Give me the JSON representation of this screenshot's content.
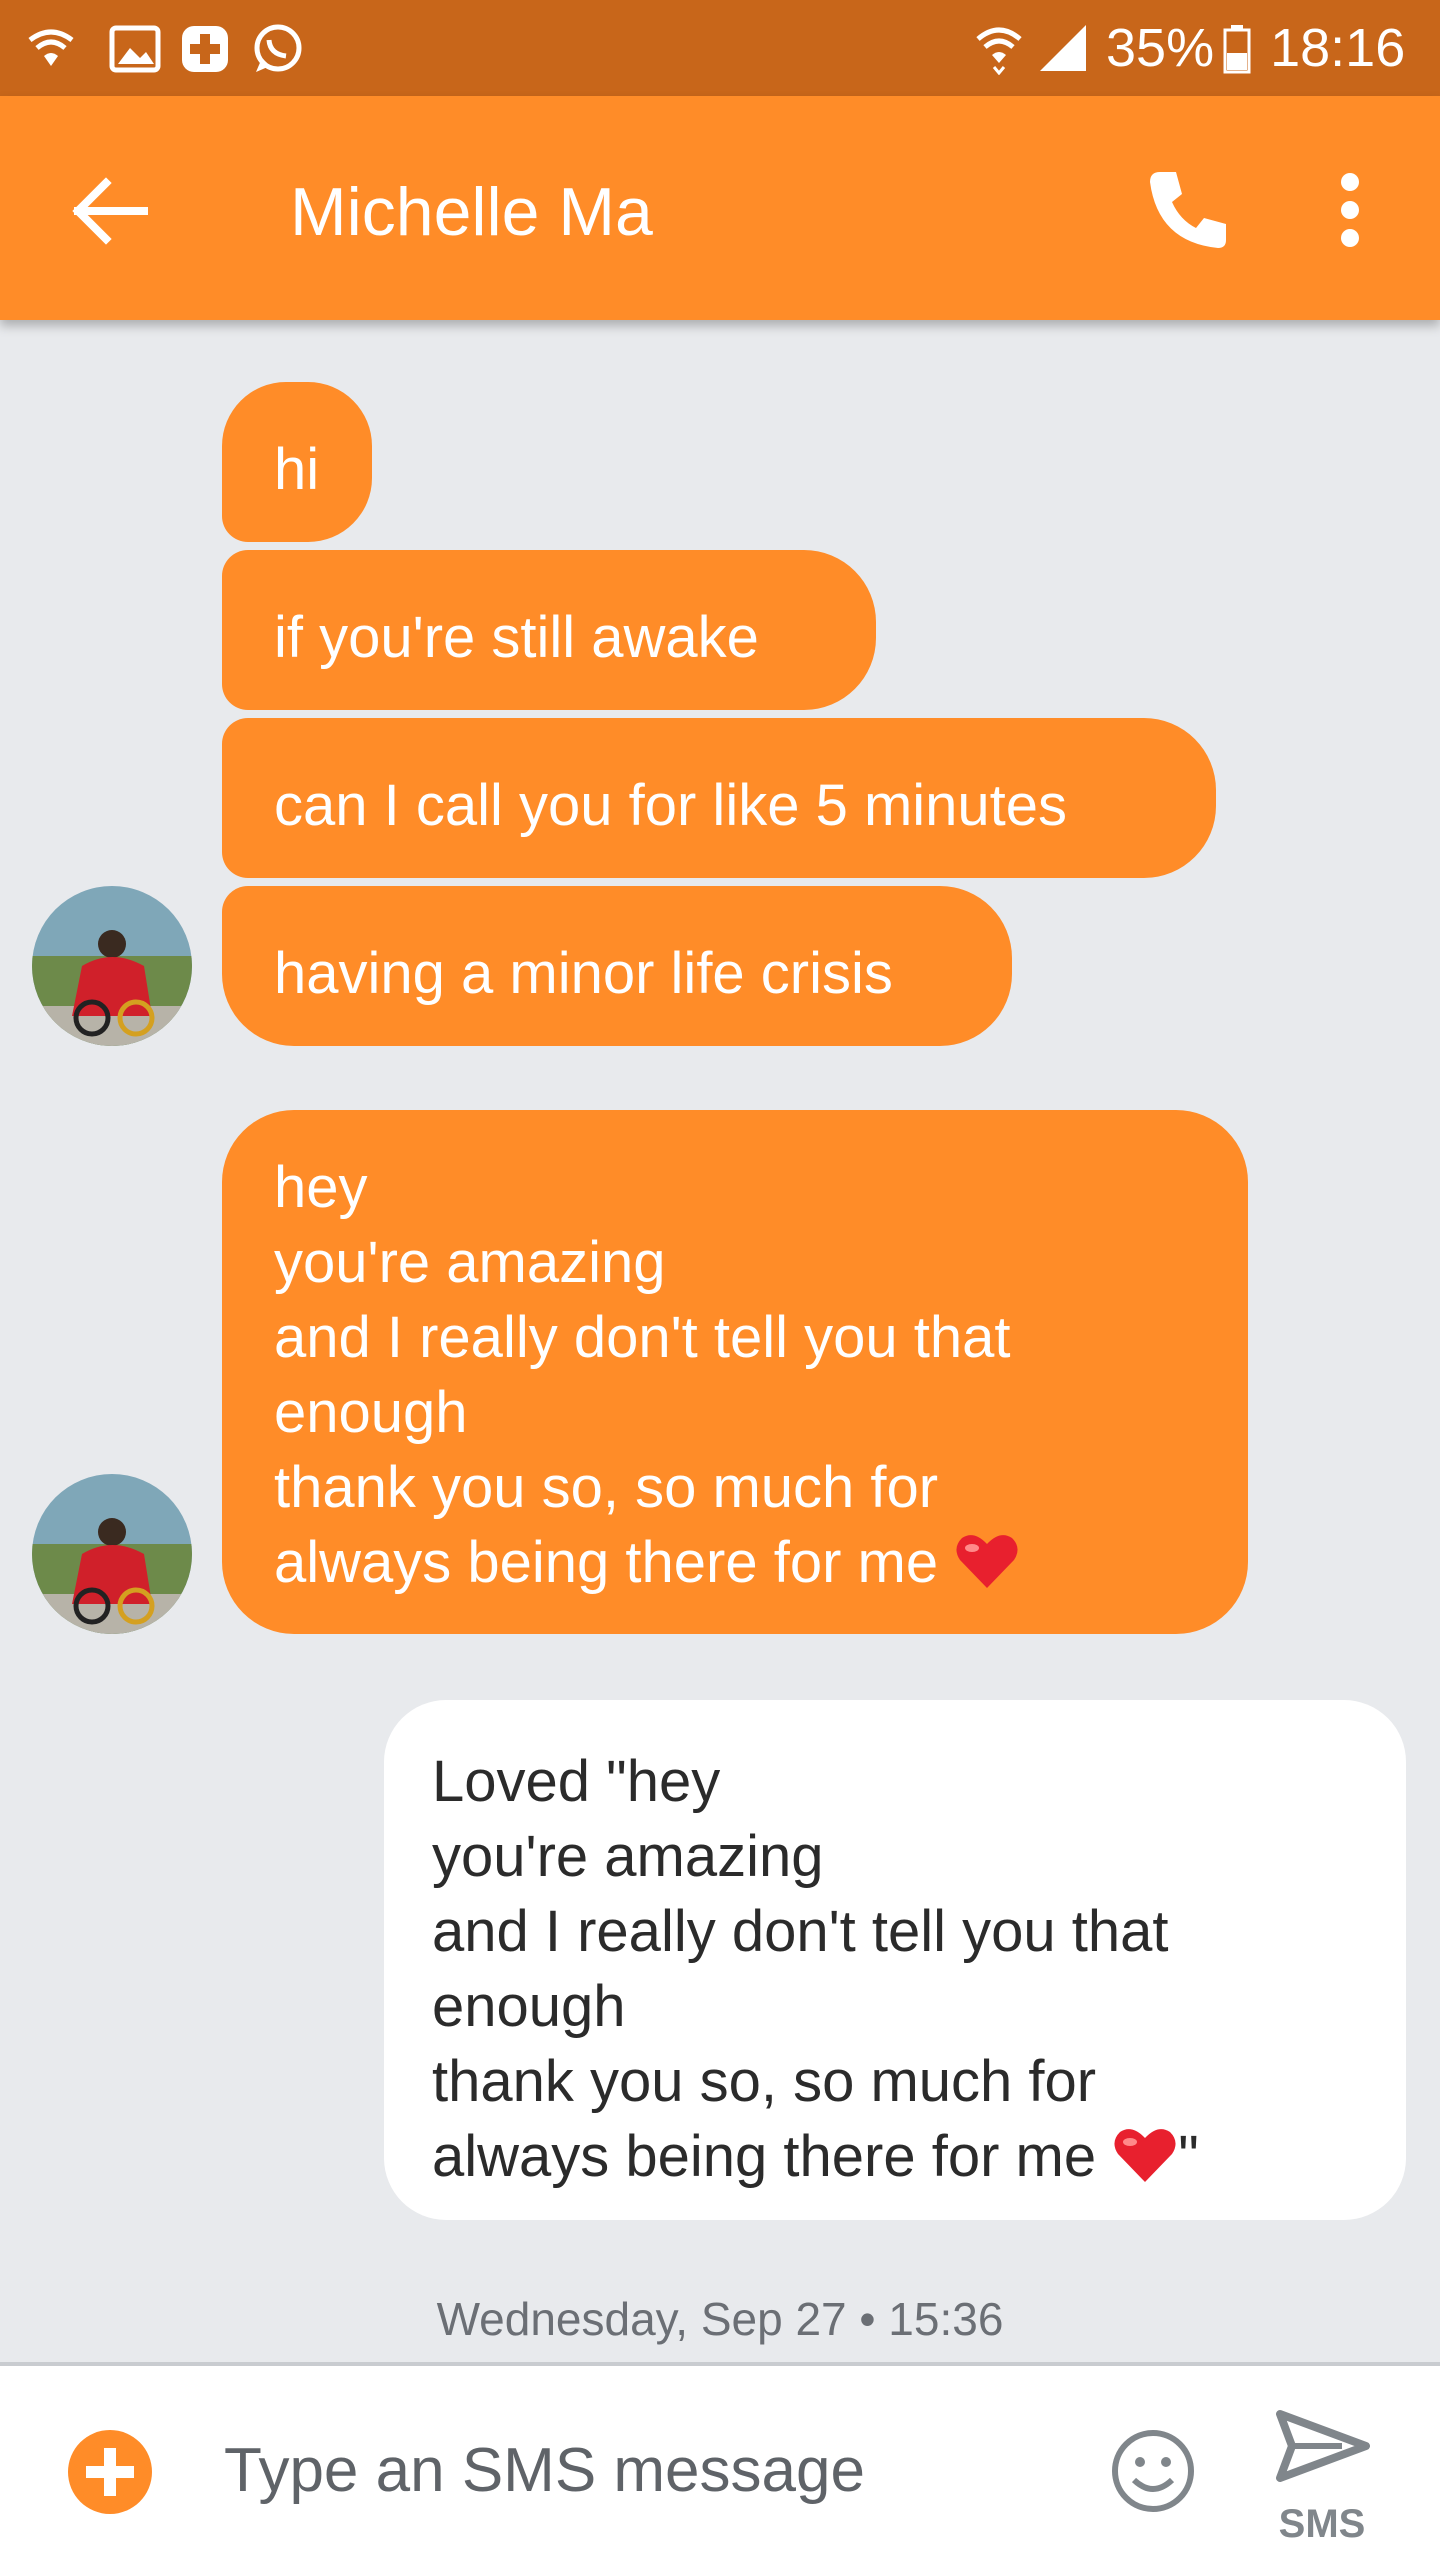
{
  "status_bar": {
    "battery": "35%",
    "time": "18:16",
    "left_icons": [
      "wifi-call-icon",
      "image-icon",
      "health-plus-icon",
      "whatsapp-icon"
    ],
    "right_icons": [
      "wifi-icon",
      "signal-icon",
      "battery-icon"
    ]
  },
  "header": {
    "title": "Michelle Ma",
    "icons": [
      "back-arrow-icon",
      "phone-icon",
      "more-vert-icon"
    ],
    "color": "#ff8c28"
  },
  "messages": [
    {
      "from": "contact",
      "text": "hi"
    },
    {
      "from": "contact",
      "text": "if you're still awake"
    },
    {
      "from": "contact",
      "text": "can I call you for like 5 minutes"
    },
    {
      "from": "contact",
      "text": "having a minor life crisis"
    },
    {
      "from": "contact",
      "text": "hey\nyou're amazing\nand I really don't tell you that\nenough\nthank you so, so much for\nalways being there for me"
    },
    {
      "from": "me",
      "text": "Loved \"hey\nyou're amazing\nand I really don't tell you that\nenough\nthank you so, so much for\nalways being there for me",
      "suffix": "\""
    }
  ],
  "timestamp": "Wednesday, Sep 27 • 15:36",
  "compose": {
    "placeholder": "Type an SMS message",
    "send_label": "SMS",
    "icons": [
      "add-icon",
      "emoji-icon",
      "send-icon"
    ]
  },
  "colors": {
    "accent": "#ff8c28",
    "status_bar": "#c8661a",
    "background": "#e8eaed"
  }
}
